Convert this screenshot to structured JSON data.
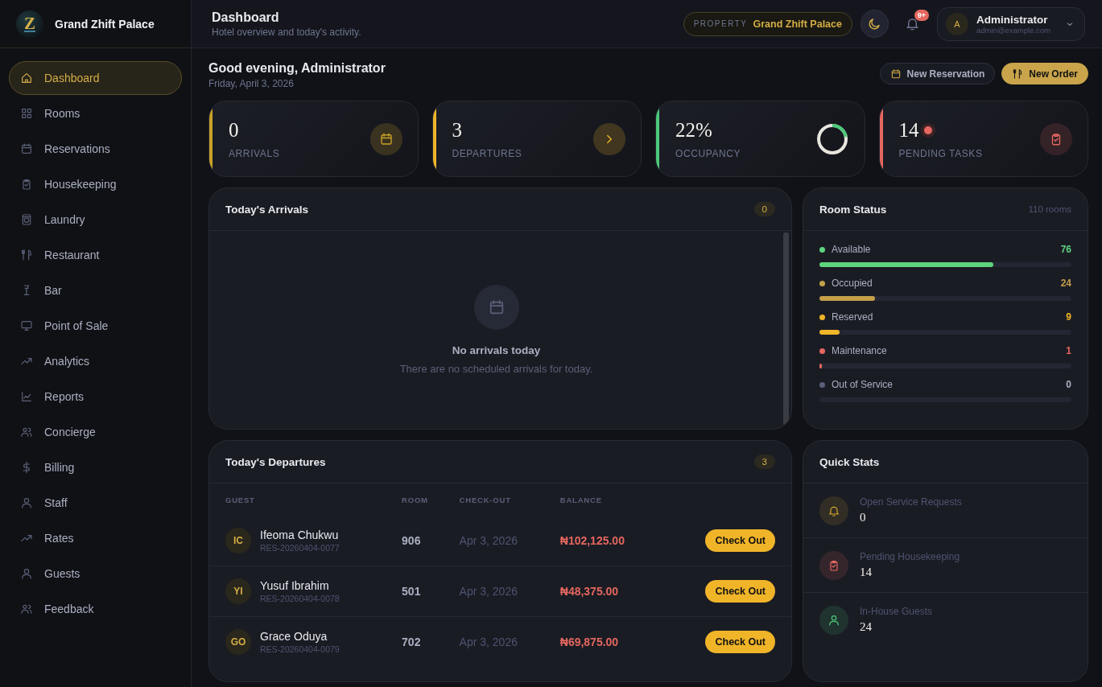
{
  "brand": {
    "logo": "Z",
    "name": "Grand Zhift Palace"
  },
  "sidebar": {
    "items": [
      {
        "label": "Dashboard",
        "selected": true
      },
      {
        "label": "Rooms",
        "selected": false
      },
      {
        "label": "Reservations",
        "selected": false
      },
      {
        "label": "Housekeeping",
        "selected": false
      },
      {
        "label": "Laundry",
        "selected": false
      },
      {
        "label": "Restaurant",
        "selected": false
      },
      {
        "label": "Bar",
        "selected": false
      },
      {
        "label": "Point of Sale",
        "selected": false
      },
      {
        "label": "Analytics",
        "selected": false
      },
      {
        "label": "Reports",
        "selected": false
      },
      {
        "label": "Concierge",
        "selected": false
      },
      {
        "label": "Billing",
        "selected": false
      },
      {
        "label": "Staff",
        "selected": false
      },
      {
        "label": "Rates",
        "selected": false
      },
      {
        "label": "Guests",
        "selected": false
      },
      {
        "label": "Feedback",
        "selected": false
      }
    ]
  },
  "header": {
    "title": "Dashboard",
    "subtitle": "Hotel overview and today's activity.",
    "property_label": "PROPERTY",
    "property_name": "Grand Zhift Palace",
    "notification_badge": "9+",
    "user": {
      "initial": "A",
      "name": "Administrator",
      "email": "admin@example.com"
    }
  },
  "greeting": {
    "title": "Good evening, Administrator",
    "date": "Friday, April 3, 2026",
    "buttons": [
      {
        "label": "New Reservation",
        "kind": "secondary"
      },
      {
        "label": "New Order",
        "kind": "primary"
      }
    ]
  },
  "stats": [
    {
      "value": "0",
      "label": "ARRIVALS",
      "color": "#c9a227",
      "kind": "icon",
      "alert": false
    },
    {
      "value": "3",
      "label": "DEPARTURES",
      "color": "#f0b429",
      "kind": "arrow",
      "alert": false
    },
    {
      "value": "22%",
      "label": "OCCUPANCY",
      "color": "#4cc97a",
      "kind": "ring",
      "level": 0.22,
      "alert": false
    },
    {
      "value": "14",
      "label": "PENDING TASKS",
      "color": "#e5675f",
      "kind": "tasks",
      "alert": true
    }
  ],
  "arrivals": {
    "title": "Today's Arrivals",
    "count": "0",
    "empty_title": "No arrivals today",
    "empty_text": "There are no scheduled arrivals for today."
  },
  "room_status": {
    "title": "Room Status",
    "total": "110 rooms",
    "items": [
      {
        "label": "Available",
        "count": "76",
        "color": "#5fd37e",
        "level": 0.69
      },
      {
        "label": "Occupied",
        "count": "24",
        "color": "#c3a04a",
        "level": 0.22
      },
      {
        "label": "Reserved",
        "count": "9",
        "color": "#f0b429",
        "level": 0.08
      },
      {
        "label": "Maintenance",
        "count": "1",
        "color": "#e5675f",
        "level": 0.01
      },
      {
        "label": "Out of Service",
        "count": "0",
        "color": "#5a5f7a",
        "level": 0
      }
    ]
  },
  "departures": {
    "title": "Today's Departures",
    "count": "3",
    "columns": [
      "GUEST",
      "ROOM",
      "CHECK-OUT",
      "BALANCE"
    ],
    "rows": [
      {
        "initials": "IC",
        "name": "Ifeoma Chukwu",
        "reference": "RES-20260404-0077",
        "room": "906",
        "checkout": "Apr 3, 2026",
        "balance": "₦102,125.00",
        "action": "Check Out"
      },
      {
        "initials": "YI",
        "name": "Yusuf Ibrahim",
        "reference": "RES-20260404-0078",
        "room": "501",
        "checkout": "Apr 3, 2026",
        "balance": "₦48,375.00",
        "action": "Check Out"
      },
      {
        "initials": "GO",
        "name": "Grace Oduya",
        "reference": "RES-20260404-0079",
        "room": "702",
        "checkout": "Apr 3, 2026",
        "balance": "₦69,875.00",
        "action": "Check Out"
      }
    ]
  },
  "quick_stats": {
    "title": "Quick Stats",
    "items": [
      {
        "label": "Open Service Requests",
        "value": "0",
        "color": "#d4a72c"
      },
      {
        "label": "Pending Housekeeping",
        "value": "14",
        "color": "#e5675f"
      },
      {
        "label": "In-House Guests",
        "value": "24",
        "color": "#4cc97a"
      }
    ]
  }
}
